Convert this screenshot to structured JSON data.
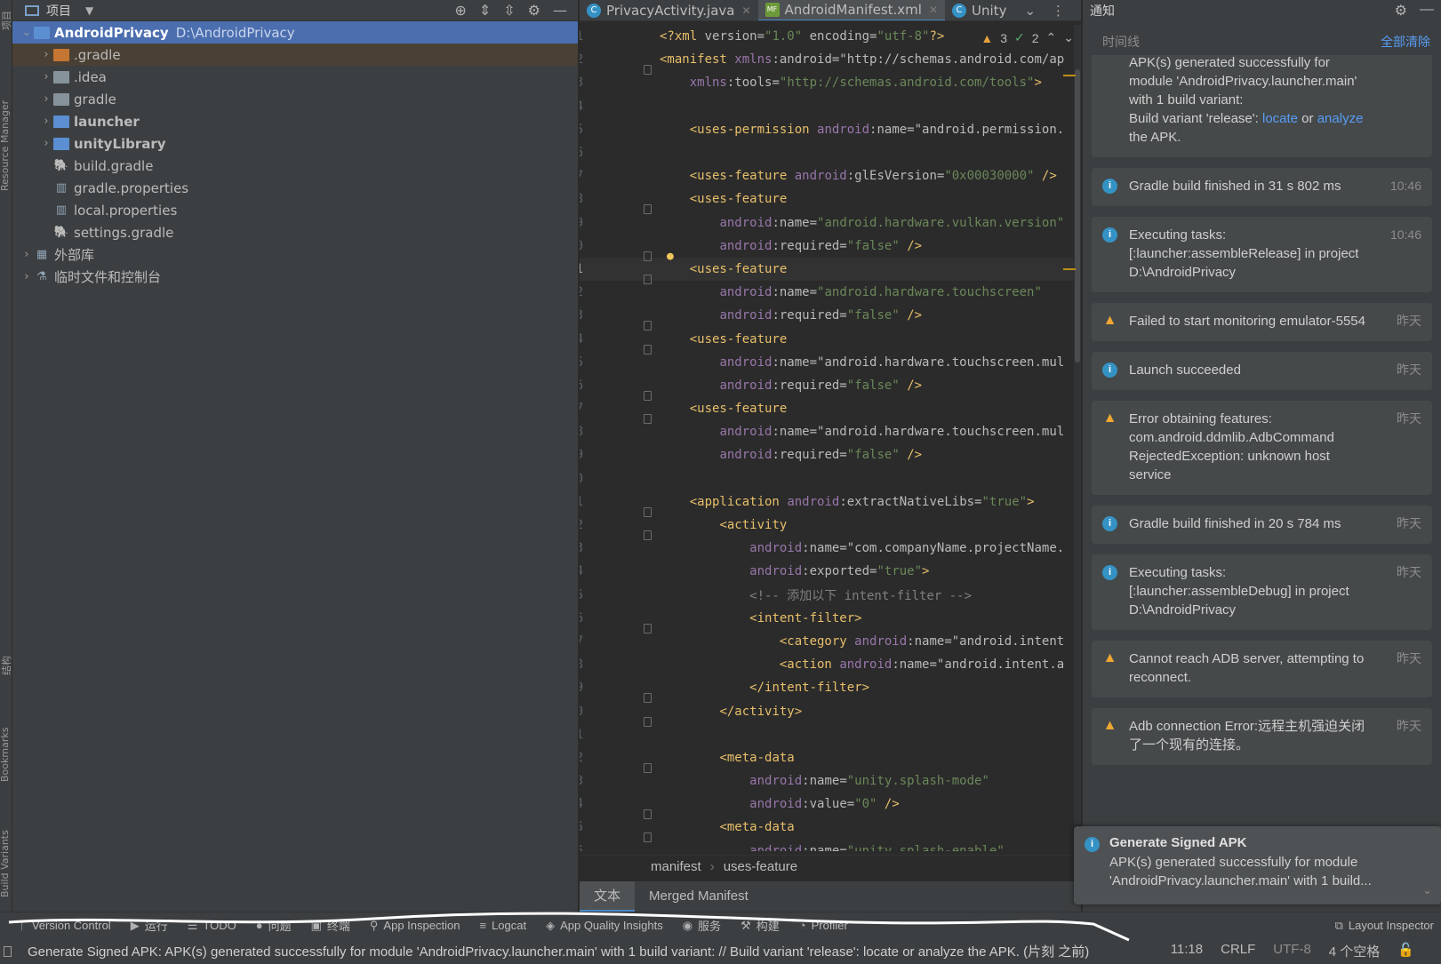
{
  "left_strip": {
    "labels": [
      "项目",
      "Resource Manager",
      "结构",
      "Bookmarks",
      "Build Variants"
    ]
  },
  "project_panel": {
    "title": "项目",
    "tree": [
      {
        "name": "AndroidPrivacy",
        "extra": "D:\\AndroidPrivacy",
        "depth": 0,
        "expanded": true,
        "icon": "module-folder-icon",
        "selected": true,
        "bold": true
      },
      {
        "name": ".gradle",
        "depth": 1,
        "collapsed": true,
        "icon": "folder-orange-icon",
        "highlight": true
      },
      {
        "name": ".idea",
        "depth": 1,
        "collapsed": true,
        "icon": "folder-icon"
      },
      {
        "name": "gradle",
        "depth": 1,
        "collapsed": true,
        "icon": "folder-icon"
      },
      {
        "name": "launcher",
        "depth": 1,
        "collapsed": true,
        "icon": "module-folder-icon",
        "bold": true
      },
      {
        "name": "unityLibrary",
        "depth": 1,
        "collapsed": true,
        "icon": "library-module-icon",
        "bold": true
      },
      {
        "name": "build.gradle",
        "depth": 1,
        "icon": "gradle-elephant-icon"
      },
      {
        "name": "gradle.properties",
        "depth": 1,
        "icon": "properties-file-icon"
      },
      {
        "name": "local.properties",
        "depth": 1,
        "icon": "properties-file-icon"
      },
      {
        "name": "settings.gradle",
        "depth": 1,
        "icon": "gradle-elephant-icon"
      },
      {
        "name": "外部库",
        "depth": 0,
        "collapsed": true,
        "icon": "external-libraries-icon"
      },
      {
        "name": "临时文件和控制台",
        "depth": 0,
        "collapsed": true,
        "icon": "scratches-icon"
      }
    ]
  },
  "editor": {
    "tabs": [
      {
        "label": "PrivacyActivity.java",
        "icon": "C",
        "active": false
      },
      {
        "label": "AndroidManifest.xml",
        "icon": "MF",
        "active": true
      },
      {
        "label": "Unity",
        "icon": "C",
        "active": false
      }
    ],
    "inspection": {
      "warnings": "3",
      "weak": "2"
    },
    "current_line": 11,
    "lines": [
      "<?xml version=\"1.0\" encoding=\"utf-8\"?>",
      "<manifest xmlns:android=\"http://schemas.android.com/ap",
      "    xmlns:tools=\"http://schemas.android.com/tools\">",
      "",
      "    <uses-permission android:name=\"android.permission.",
      "",
      "    <uses-feature android:glEsVersion=\"0x00030000\" />",
      "    <uses-feature",
      "        android:name=\"android.hardware.vulkan.version\"",
      "        android:required=\"false\" />",
      "    <uses-feature",
      "        android:name=\"android.hardware.touchscreen\"",
      "        android:required=\"false\" />",
      "    <uses-feature",
      "        android:name=\"android.hardware.touchscreen.mul",
      "        android:required=\"false\" />",
      "    <uses-feature",
      "        android:name=\"android.hardware.touchscreen.mul",
      "        android:required=\"false\" />",
      "",
      "    <application android:extractNativeLibs=\"true\">",
      "        <activity",
      "            android:name=\"com.companyName.projectName.",
      "            android:exported=\"true\">",
      "            <!-- 添加以下 intent-filter -->",
      "            <intent-filter>",
      "                <category android:name=\"android.intent",
      "                <action android:name=\"android.intent.a",
      "            </intent-filter>",
      "        </activity>",
      "",
      "        <meta-data",
      "            android:name=\"unity.splash-mode\"",
      "            android:value=\"0\" />",
      "        <meta-data",
      "            android:name=\"unity.splash-enable\""
    ],
    "fold_lines": [
      2,
      8,
      10,
      11,
      13,
      14,
      16,
      17,
      21,
      22,
      26,
      29,
      30,
      32,
      34,
      35
    ],
    "bulb_line": 10,
    "breadcrumbs": [
      "manifest",
      "uses-feature"
    ],
    "bottom_tabs": [
      {
        "label": "文本",
        "active": true
      },
      {
        "label": "Merged Manifest",
        "active": false
      }
    ]
  },
  "notifications": {
    "title": "通知",
    "timeline_label": "时间线",
    "clear_all": "全部清除",
    "items": [
      {
        "kind": "top",
        "text_pre": "APK(s) generated successfully for module 'AndroidPrivacy.launcher.main' with 1 build variant:",
        "text_line2_pre": "Build variant 'release': ",
        "link1": "locate",
        "mid": " or ",
        "link2": "analyze",
        "text_post": " the APK.",
        "time": ""
      },
      {
        "kind": "info",
        "text": "Gradle build finished in 31 s 802 ms",
        "time": "10:46"
      },
      {
        "kind": "info",
        "text": "Executing tasks: [:launcher:assembleRelease] in project D:\\AndroidPrivacy",
        "time": "10:46"
      },
      {
        "kind": "warn",
        "text": "Failed to start monitoring emulator-5554",
        "time": "昨天"
      },
      {
        "kind": "info",
        "text": "Launch succeeded",
        "time": "昨天"
      },
      {
        "kind": "warn",
        "text": "Error obtaining features: com.android.ddmlib.AdbCommand RejectedException: unknown host service",
        "time": "昨天"
      },
      {
        "kind": "info",
        "text": "Gradle build finished in 20 s 784 ms",
        "time": "昨天"
      },
      {
        "kind": "info",
        "text": "Executing tasks: [:launcher:assembleDebug] in project D:\\AndroidPrivacy",
        "time": "昨天"
      },
      {
        "kind": "warn",
        "text": "Cannot reach ADB server, attempting to reconnect.",
        "time": "昨天"
      },
      {
        "kind": "warn",
        "text": "Adb connection Error:远程主机强迫关闭了一个现有的连接。",
        "time": "昨天"
      }
    ],
    "popup": {
      "title": "Generate Signed APK",
      "body": "APK(s) generated successfully for module 'AndroidPrivacy.launcher.main' with 1 build..."
    }
  },
  "tool_windows": [
    {
      "label": "Version Control",
      "icon": "version-control-icon"
    },
    {
      "label": "运行",
      "icon": "run-icon"
    },
    {
      "label": "TODO",
      "icon": "todo-icon"
    },
    {
      "label": "问题",
      "icon": "problems-icon"
    },
    {
      "label": "终端",
      "icon": "terminal-icon"
    },
    {
      "label": "App Inspection",
      "icon": "app-inspection-icon"
    },
    {
      "label": "Logcat",
      "icon": "logcat-icon"
    },
    {
      "label": "App Quality Insights",
      "icon": "app-quality-icon"
    },
    {
      "label": "服务",
      "icon": "services-icon"
    },
    {
      "label": "构建",
      "icon": "build-icon"
    },
    {
      "label": "Profiler",
      "icon": "profiler-icon"
    }
  ],
  "tool_window_right": {
    "label": "Layout Inspector",
    "icon": "layout-inspector-icon"
  },
  "status_bar": {
    "message": "Generate Signed APK: APK(s) generated successfully for module 'AndroidPrivacy.launcher.main' with 1 build variant: // Build variant 'release': locate or analyze the APK. (片刻 之前)",
    "position": "11:18",
    "line_sep": "CRLF",
    "encoding": "UTF-8",
    "indent": "4 个空格"
  },
  "colors": {
    "accent": "#4b6eaf",
    "link": "#589df6",
    "tag": "#e8bf6a",
    "attr": "#bababa",
    "ns": "#9876aa",
    "string": "#6a8759",
    "comment": "#808080",
    "warning": "#f0a732"
  }
}
